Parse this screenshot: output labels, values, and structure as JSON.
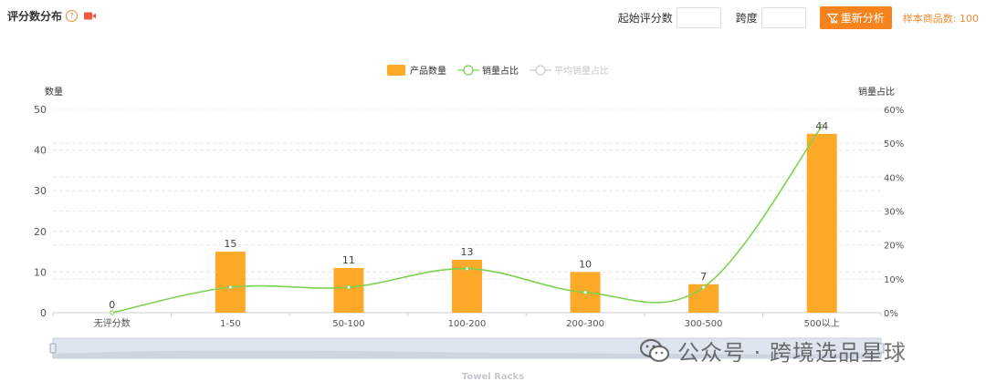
{
  "header": {
    "title": "评分数分布",
    "help_symbol": "?",
    "icons": {
      "help": "question-circle-icon",
      "video": "video-camera-icon",
      "filter": "filter-icon"
    },
    "start_score_label": "起始评分数",
    "start_score_value": "",
    "span_label": "跨度",
    "span_value": "",
    "reanalyze_button": "重新分析",
    "sample_count_text": "样本商品数: 100"
  },
  "chart_data": {
    "type": "bar",
    "categories": [
      "无评分数",
      "1-50",
      "50-100",
      "100-200",
      "200-300",
      "300-500",
      "500以上"
    ],
    "series": [
      {
        "name": "产品数量",
        "type": "bar",
        "axis": "left",
        "values": [
          0,
          15,
          11,
          13,
          10,
          7,
          44
        ],
        "color": "#ffa928"
      },
      {
        "name": "销量占比",
        "type": "line",
        "axis": "right",
        "values": [
          0,
          7.5,
          7.5,
          13,
          6,
          7.5,
          55
        ],
        "color": "#7ed151"
      },
      {
        "name": "平均销量占比",
        "type": "line",
        "axis": "right",
        "values": [],
        "color": "#cccccc",
        "hidden": true
      }
    ],
    "ylabel_left": "数量",
    "ylabel_right": "销量占比",
    "ylim_left": [
      0,
      50
    ],
    "ylim_right": [
      0,
      60
    ],
    "yticks_left": [
      "0",
      "10",
      "20",
      "30",
      "40",
      "50"
    ],
    "yticks_right": [
      "0%",
      "10%",
      "20%",
      "30%",
      "40%",
      "50%",
      "60%"
    ],
    "grid": true,
    "legend_position": "top-center",
    "data_labels": true,
    "zoom_slider_label": "Towel Racks"
  },
  "watermark": {
    "text": "公众号 · 跨境选品星球",
    "icon": "wechat-icon"
  }
}
